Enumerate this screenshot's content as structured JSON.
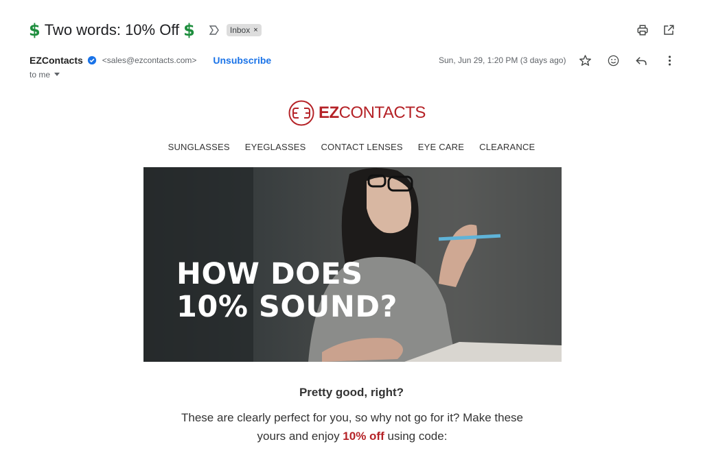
{
  "subject": {
    "prefix_emoji": "$",
    "text": "Two words: 10% Off",
    "suffix_emoji": "$",
    "label_chip": "Inbox",
    "label_chip_close": "×"
  },
  "toolbar_icons": [
    "print-icon",
    "open-in-new-window-icon"
  ],
  "sender": {
    "name": "EZContacts",
    "email": "<sales@ezcontacts.com>",
    "unsubscribe": "Unsubscribe",
    "recipient": "to me",
    "date": "Sun, Jun 29, 1:20 PM (3 days ago)"
  },
  "message_icons": [
    "star-icon",
    "emoji-icon",
    "reply-icon",
    "more-vert-icon"
  ],
  "email": {
    "logo_bold": "EZ",
    "logo_rest": "CONTACTS",
    "nav": [
      "SUNGLASSES",
      "EYEGLASSES",
      "CONTACT LENSES",
      "EYE CARE",
      "CLEARANCE"
    ],
    "hero_line1": "HOW DOES",
    "hero_line2": "10% SOUND?",
    "heading": "Pretty good, right?",
    "para_part1": "These are clearly perfect for you, so why not go for it? Make these yours and enjoy ",
    "para_highlight": "10% off",
    "para_part2": " using code:"
  },
  "colors": {
    "brand_red": "#b52227",
    "link_blue": "#1a73e8",
    "dollar_green": "#1e8e3e",
    "verified_blue": "#1a73e8"
  }
}
